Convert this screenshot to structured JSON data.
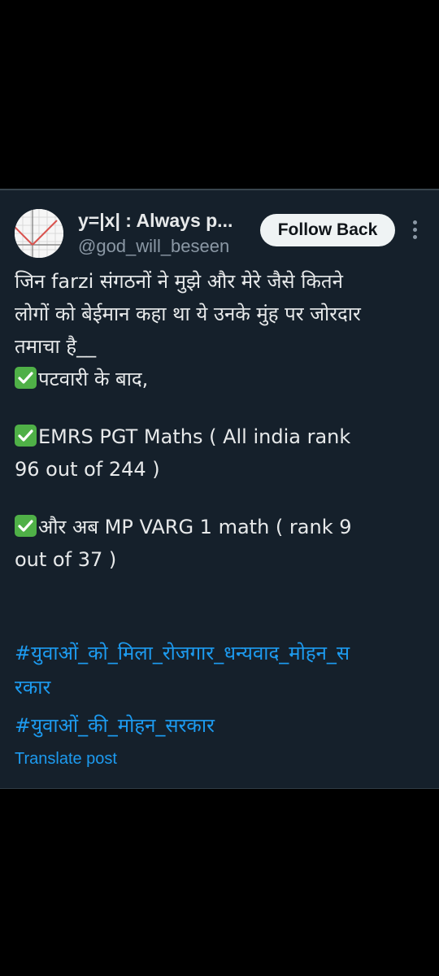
{
  "post": {
    "author": {
      "display_name": "y=|x| : Always p...",
      "handle": "@god_will_beseen",
      "avatar_icon": "graph-avatar"
    },
    "follow_label": "Follow Back",
    "more_icon": "more-vertical-icon",
    "text_lines": [
      "जिन farzi संगठनों ने मुझे और मेरे जैसे कितने",
      "लोगों को बेईमान कहा था ये उनके मुंह पर जोरदार",
      "तमाचा है__"
    ],
    "items": [
      {
        "icon": "check-mark-icon",
        "lines": [
          "पटवारी के बाद,"
        ]
      },
      {
        "icon": "check-mark-icon",
        "lines": [
          "EMRS PGT Maths ( All india rank",
          "96 out of 244 )"
        ]
      },
      {
        "icon": "check-mark-icon",
        "lines": [
          "और अब MP VARG 1 math ( rank 9",
          "out of 37 )"
        ]
      }
    ],
    "hashtags": [
      "#युवाओं_को_मिला_रोजगार_धन्यवाद_मोहन_स",
      "रकार",
      "#युवाओं_की_मोहन_सरकार"
    ],
    "translate_label": "Translate post"
  },
  "colors": {
    "background": "#000000",
    "card": "#15202b",
    "text": "#e7e9ea",
    "muted": "#8b98a5",
    "link": "#1d9bf0",
    "check": "#4fb047",
    "button_bg": "#eff3f4"
  }
}
